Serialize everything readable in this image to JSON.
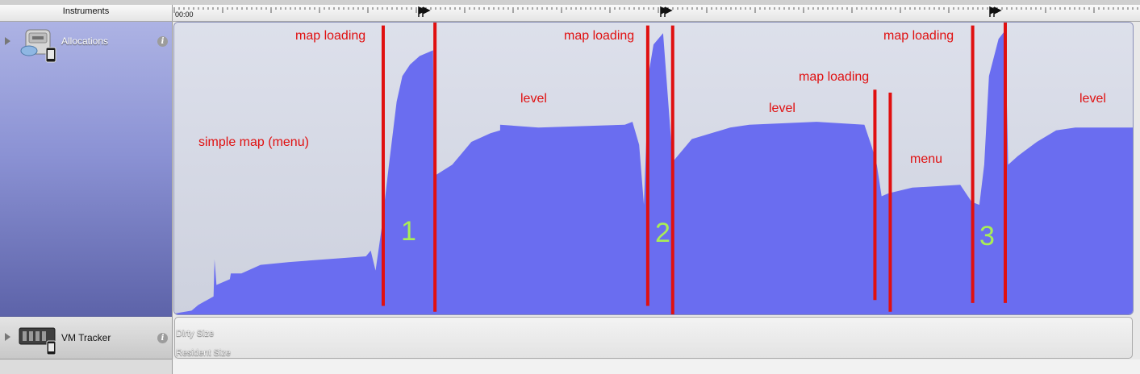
{
  "header": {
    "instruments_label": "Instruments",
    "time_start": "00:00"
  },
  "instruments": [
    {
      "name": "Allocations",
      "info_label": "i"
    },
    {
      "name": "VM Tracker",
      "info_label": "i"
    }
  ],
  "vm_tracker": {
    "metrics": [
      "Dirty Size",
      "Resident Size"
    ]
  },
  "annotations": {
    "texts": [
      "simple map (menu)",
      "map loading",
      "level",
      "map loading",
      "level",
      "map loading",
      "menu",
      "map loading",
      "level"
    ],
    "markers": [
      "1",
      "2",
      "3"
    ]
  },
  "allocations_graph": {
    "fill_color": "#6a6df0",
    "marker_line_color": "#e01010",
    "profile": [
      [
        0,
        0.0
      ],
      [
        0.018,
        0.01
      ],
      [
        0.025,
        0.03
      ],
      [
        0.041,
        0.06
      ],
      [
        0.042,
        0.19
      ],
      [
        0.044,
        0.1
      ],
      [
        0.058,
        0.12
      ],
      [
        0.059,
        0.14
      ],
      [
        0.07,
        0.14
      ],
      [
        0.09,
        0.17
      ],
      [
        0.12,
        0.18
      ],
      [
        0.2,
        0.2
      ],
      [
        0.205,
        0.22
      ],
      [
        0.21,
        0.15
      ],
      [
        0.216,
        0.29
      ],
      [
        0.224,
        0.52
      ],
      [
        0.232,
        0.74
      ],
      [
        0.238,
        0.83
      ],
      [
        0.246,
        0.87
      ],
      [
        0.256,
        0.9
      ],
      [
        0.27,
        0.92
      ],
      [
        0.271,
        0.48
      ],
      [
        0.29,
        0.52
      ],
      [
        0.3,
        0.56
      ],
      [
        0.31,
        0.6
      ],
      [
        0.33,
        0.63
      ],
      [
        0.34,
        0.64
      ],
      [
        0.34,
        0.66
      ],
      [
        0.38,
        0.65
      ],
      [
        0.47,
        0.66
      ],
      [
        0.478,
        0.67
      ],
      [
        0.485,
        0.59
      ],
      [
        0.49,
        0.38
      ],
      [
        0.495,
        0.84
      ],
      [
        0.5,
        0.94
      ],
      [
        0.51,
        0.98
      ],
      [
        0.52,
        0.53
      ],
      [
        0.54,
        0.61
      ],
      [
        0.58,
        0.65
      ],
      [
        0.6,
        0.66
      ],
      [
        0.67,
        0.67
      ],
      [
        0.72,
        0.66
      ],
      [
        0.728,
        0.58
      ],
      [
        0.733,
        0.52
      ],
      [
        0.738,
        0.41
      ],
      [
        0.745,
        0.42
      ],
      [
        0.77,
        0.44
      ],
      [
        0.82,
        0.45
      ],
      [
        0.832,
        0.39
      ],
      [
        0.84,
        0.38
      ],
      [
        0.845,
        0.52
      ],
      [
        0.85,
        0.83
      ],
      [
        0.86,
        0.96
      ],
      [
        0.867,
        0.99
      ],
      [
        0.87,
        0.52
      ],
      [
        0.88,
        0.55
      ],
      [
        0.9,
        0.6
      ],
      [
        0.92,
        0.64
      ],
      [
        0.94,
        0.65
      ],
      [
        1.0,
        0.65
      ]
    ],
    "marker_lines": [
      [
        0.218,
        0.04,
        0.99
      ],
      [
        0.272,
        0.02,
        1.0
      ],
      [
        0.494,
        0.04,
        0.99
      ],
      [
        0.52,
        0.0,
        0.99
      ],
      [
        0.731,
        0.06,
        0.77
      ],
      [
        0.747,
        0.02,
        0.76
      ],
      [
        0.833,
        0.05,
        0.99
      ],
      [
        0.867,
        0.05,
        1.0
      ]
    ]
  }
}
